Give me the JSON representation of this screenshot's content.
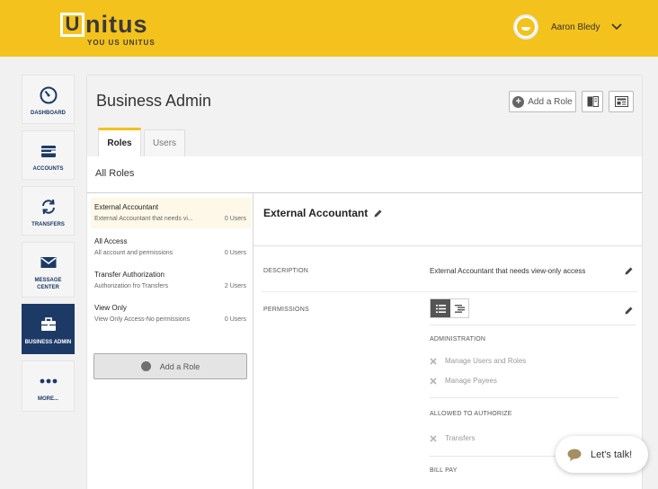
{
  "header": {
    "logo_letter": "U",
    "logo_word": "nitus",
    "logo_tagline": "YOU US UNITUS",
    "user_name": "Aaron Bledy"
  },
  "sidebar": {
    "items": [
      {
        "label": "DASHBOARD",
        "icon": "gauge-icon"
      },
      {
        "label": "ACCOUNTS",
        "icon": "wallet-icon"
      },
      {
        "label": "TRANSFERS",
        "icon": "refresh-arrows-icon"
      },
      {
        "label": "MESSAGE CENTER",
        "icon": "envelope-icon"
      },
      {
        "label": "BUSINESS ADMIN",
        "icon": "briefcase-icon",
        "active": true
      },
      {
        "label": "MORE...",
        "icon": "more-dots-icon"
      }
    ]
  },
  "main": {
    "title": "Business Admin",
    "add_role_label": "Add a Role",
    "tabs": [
      {
        "label": "Roles",
        "active": true
      },
      {
        "label": "Users",
        "active": false
      }
    ],
    "section_title": "All Roles"
  },
  "roles": [
    {
      "name": "External Accountant",
      "description": "External Accountant that needs vi...",
      "users": "0 Users",
      "selected": true
    },
    {
      "name": "All Access",
      "description": "All account and permissions",
      "users": "0 Users"
    },
    {
      "name": "Transfer Authorization",
      "description": "Authorization fro Transfers",
      "users": "2 Users"
    },
    {
      "name": "View Only",
      "description": "View Only Access-No permissions",
      "users": "0 Users"
    }
  ],
  "add_role_button": "Add a Role",
  "detail": {
    "title": "External Accountant",
    "description_label": "DESCRIPTION",
    "description_value": "External Accountant that needs view-only access",
    "permissions_label": "PERMISSIONS",
    "groups": [
      {
        "title": "ADMINISTRATION",
        "items": [
          "Manage Users and Roles",
          "Manage Payees"
        ]
      },
      {
        "title": "ALLOWED TO AUTHORIZE",
        "items": [
          "Transfers"
        ]
      },
      {
        "title": "BILL PAY",
        "items": []
      }
    ]
  },
  "chat": {
    "label": "Let's talk!"
  },
  "colors": {
    "brand_yellow": "#f3c21d",
    "navy": "#1d3a66"
  }
}
